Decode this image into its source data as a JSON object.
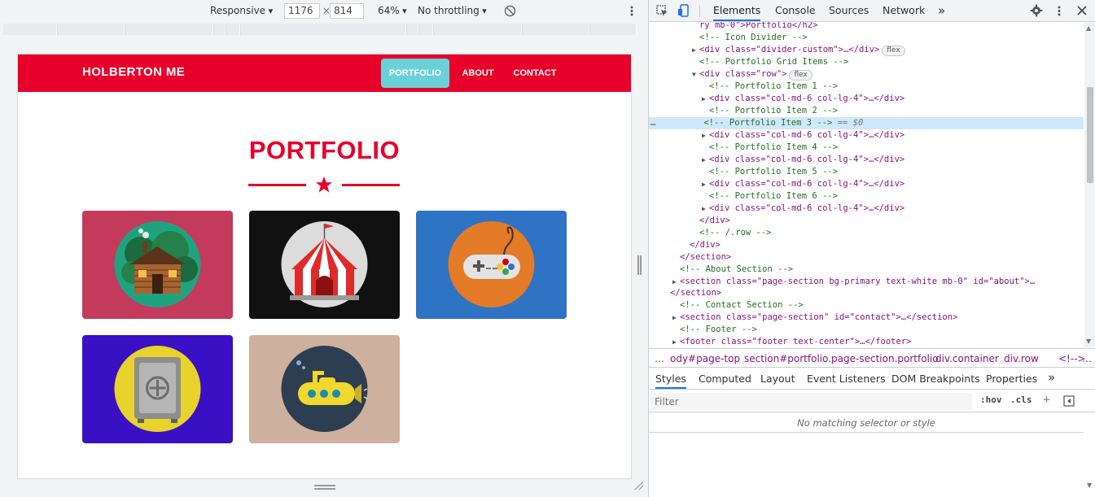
{
  "device_toolbar": {
    "mode": "Responsive",
    "width": "1176",
    "times": "×",
    "height": "814",
    "zoom": "64%",
    "throttling": "No throttling"
  },
  "site": {
    "brand": "HOLBERTON ME",
    "nav": [
      "PORTFOLIO",
      "ABOUT",
      "CONTACT"
    ],
    "heading": "PORTFOLIO",
    "tiles": [
      {
        "name": "cabin",
        "bg": "#c33a5c",
        "circle": "#1fa37f"
      },
      {
        "name": "circus-tent",
        "bg": "#111111",
        "circle": "#dcdcdc"
      },
      {
        "name": "game-controller",
        "bg": "#2e73c4",
        "circle": "#e47b28"
      },
      {
        "name": "safe",
        "bg": "#3a10c4",
        "circle": "#e8d22c"
      },
      {
        "name": "submarine",
        "bg": "#cdb09e",
        "circle": "#2c3e50"
      }
    ],
    "colors": {
      "primary": "#e6002a",
      "active": "#6ad1d8"
    }
  },
  "devtools": {
    "tabs": [
      "Elements",
      "Console",
      "Sources",
      "Network",
      "»"
    ],
    "tree": [
      "ry mb-0\">Portfolio</h2>",
      "<!-- Icon Divider -->",
      "<div class=\"divider-custom\">…</div>",
      "<!-- Portfolio Grid Items -->",
      "<div class=\"row\">",
      "<!-- Portfolio Item 1 -->",
      "<div class=\"col-md-6 col-lg-4\">…</div>",
      "<!-- Portfolio Item 2 -->",
      "<!-- Portfolio Item 3 -->",
      "<div class=\"col-md-6 col-lg-4\">…</div>",
      "<!-- Portfolio Item 4 -->",
      "<div class=\"col-md-6 col-lg-4\">…</div>",
      "<!-- Portfolio Item 5 -->",
      "<div class=\"col-md-6 col-lg-4\">…</div>",
      "<!-- Portfolio Item 6 -->",
      "<div class=\"col-md-6 col-lg-4\">…</div>",
      "</div>",
      "<!-- /.row -->",
      "</div>",
      "</section>",
      "<!-- About Section -->",
      "<section class=\"page-section bg-primary text-white mb-0\" id=\"about\">…",
      "</section>",
      "<!-- Contact Section -->",
      "<section class=\"page-section\" id=\"contact\">…</section>",
      "<!-- Footer -->",
      "<footer class=\"footer text-center\">…</footer>"
    ],
    "flex_badge": "flex",
    "selected_marker": "== $0",
    "ellipsis": "…",
    "breadcrumbs": [
      "…",
      "ody#page-top",
      "section#portfolio.page-section.portfolio",
      "div.container",
      "div.row",
      "<!-->",
      "…"
    ],
    "styles_tabs": [
      "Styles",
      "Computed",
      "Layout",
      "Event Listeners",
      "DOM Breakpoints",
      "Properties",
      "»"
    ],
    "filter_placeholder": "Filter",
    "hov": ":hov",
    "cls": ".cls",
    "no_match": "No matching selector or style"
  }
}
